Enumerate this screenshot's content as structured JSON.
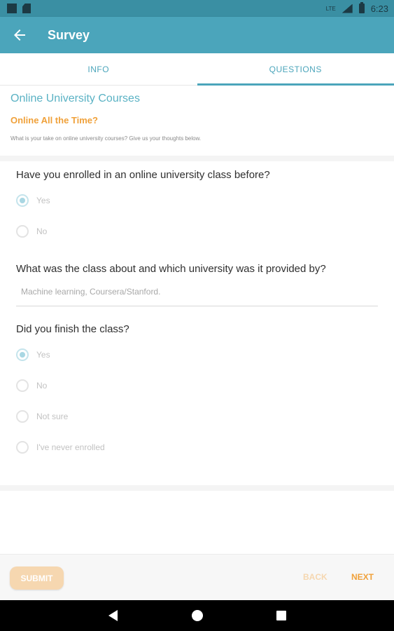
{
  "status_bar": {
    "time": "6:23",
    "network": "LTE"
  },
  "app_bar": {
    "title": "Survey"
  },
  "tabs": [
    {
      "label": "INFO",
      "active": false
    },
    {
      "label": "QUESTIONS",
      "active": true
    }
  ],
  "survey": {
    "title": "Online University Courses",
    "subtitle": "Online All the Time?",
    "description": "What is your take on online university courses? Give us your thoughts below."
  },
  "questions": [
    {
      "text": "Have you enrolled in an online university class before?",
      "type": "radio",
      "options": [
        {
          "label": "Yes",
          "checked": true
        },
        {
          "label": "No",
          "checked": false
        }
      ]
    },
    {
      "text": "What was the class about and which university was it provided by?",
      "type": "text",
      "value": "Machine learning, Coursera/Stanford."
    },
    {
      "text": "Did you finish the class?",
      "type": "radio",
      "options": [
        {
          "label": "Yes",
          "checked": true
        },
        {
          "label": "No",
          "checked": false
        },
        {
          "label": "Not sure",
          "checked": false
        },
        {
          "label": "I've never enrolled",
          "checked": false
        }
      ]
    }
  ],
  "footer": {
    "submit_label": "SUBMIT",
    "back_label": "BACK",
    "next_label": "NEXT"
  },
  "colors": {
    "primary": "#4ba5bb",
    "status_bar": "#3a8fa3",
    "accent": "#f0a13a",
    "accent_disabled": "#f6d7b0"
  }
}
